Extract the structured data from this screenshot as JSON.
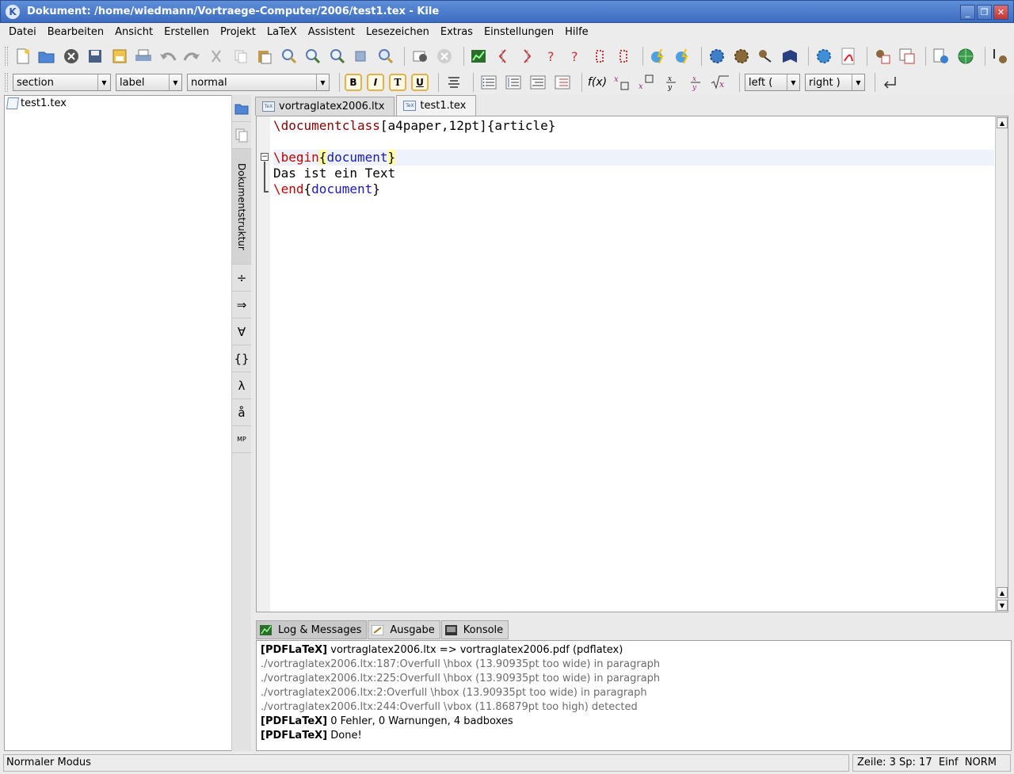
{
  "window": {
    "title": "Dokument: /home/wiedmann/Vortraege-Computer/2006/test1.tex - Kile",
    "app_icon": "K"
  },
  "menu": [
    "Datei",
    "Bearbeiten",
    "Ansicht",
    "Erstellen",
    "Projekt",
    "LaTeX",
    "Assistent",
    "Lesezeichen",
    "Extras",
    "Einstellungen",
    "Hilfe"
  ],
  "toolbar2": {
    "section_combo": "section",
    "label_combo": "label",
    "size_combo": "normal",
    "bold": "B",
    "italic": "I",
    "typewriter": "T",
    "underline": "U",
    "fx": "f(x)",
    "left_combo": "left (",
    "right_combo": "right )"
  },
  "file_tree": {
    "items": [
      "test1.tex"
    ]
  },
  "side_panel": {
    "structure_label": "Dokumentstruktur",
    "mp_label": "MP"
  },
  "editor_tabs": [
    "vortraglatex2006.ltx",
    "test1.tex"
  ],
  "editor": {
    "line1_cmd": "\\documentclass",
    "line1_rest": "[a4paper,12pt]{article}",
    "line3_cmd": "\\begin",
    "line3_arg": "document",
    "line4": "Das ist ein Text",
    "line5_cmd": "\\end",
    "line5_arg": "document"
  },
  "bottom_tabs": [
    "Log & Messages",
    "Ausgabe",
    "Konsole"
  ],
  "log": {
    "l1_tag": "[PDFLaTeX]",
    "l1_text": "vortraglatex2006.ltx => vortraglatex2006.pdf (pdflatex)",
    "l2": "./vortraglatex2006.ltx:187:Overfull \\hbox (13.90935pt too wide) in paragraph",
    "l3": "./vortraglatex2006.ltx:225:Overfull \\hbox (13.90935pt too wide) in paragraph",
    "l4": "./vortraglatex2006.ltx:2:Overfull \\hbox (13.90935pt too wide) in paragraph",
    "l5": "./vortraglatex2006.ltx:244:Overfull \\vbox (11.86879pt too high) detected",
    "l6_tag": "[PDFLaTeX]",
    "l6_text": "0 Fehler, 0 Warnungen, 4 badboxes",
    "l7_tag": "[PDFLaTeX]",
    "l7_text": "Done!"
  },
  "status": {
    "mode": "Normaler Modus",
    "position": "Zeile: 3 Sp: 17  Einf  NORM"
  }
}
